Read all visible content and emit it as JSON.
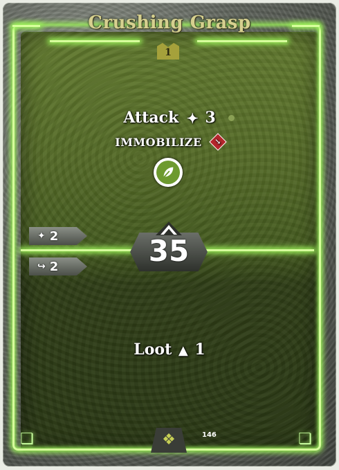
{
  "card": {
    "title": "Crushing Grasp",
    "level": "1",
    "initiative": "35",
    "card_number": "146"
  },
  "top_action": {
    "attack_label": "Attack",
    "attack_value": "3",
    "attack_icon": "attack-icon",
    "condition": "IMMOBILIZE",
    "condition_icon": "immobilize-icon",
    "element_icon": "earth-leaf-icon"
  },
  "bottom_action": {
    "loot_label": "Loot",
    "loot_value": "1",
    "loot_icon": "loot-icon"
  },
  "side_tabs": [
    {
      "icon": "attack-icon",
      "value": "2"
    },
    {
      "icon": "move-icon",
      "value": "2"
    }
  ],
  "colors": {
    "glow": "#9df35a",
    "title": "#d6d08f",
    "element": "#6d9a2f",
    "condition": "#b5262c"
  }
}
